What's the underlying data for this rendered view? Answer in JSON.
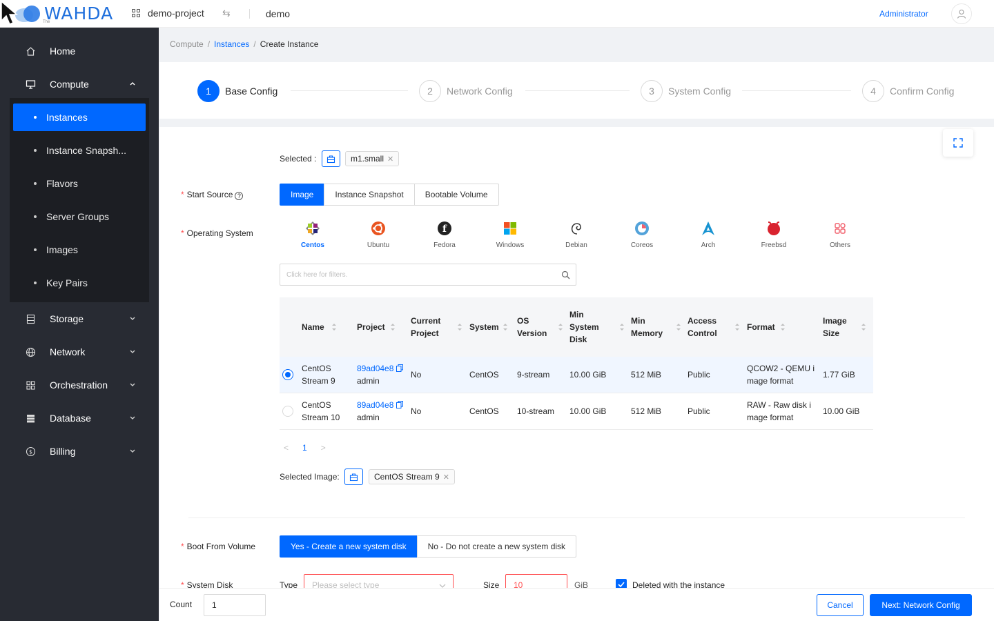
{
  "header": {
    "logo_text": "WAHDA",
    "logo_small": "The",
    "project": "demo-project",
    "domain": "demo",
    "user": "Administrator"
  },
  "sidebar": {
    "items": [
      {
        "label": "Home",
        "icon": "home-icon"
      },
      {
        "label": "Compute",
        "icon": "monitor-icon",
        "expanded": true
      },
      {
        "label": "Storage",
        "icon": "storage-icon"
      },
      {
        "label": "Network",
        "icon": "globe-icon"
      },
      {
        "label": "Orchestration",
        "icon": "grid-icon"
      },
      {
        "label": "Database",
        "icon": "database-icon"
      },
      {
        "label": "Billing",
        "icon": "dollar-icon"
      }
    ],
    "compute_children": [
      "Instances",
      "Instance Snapsh...",
      "Flavors",
      "Server Groups",
      "Images",
      "Key Pairs"
    ],
    "active_child": "Instances"
  },
  "breadcrumb": {
    "items": [
      "Compute",
      "Instances",
      "Create Instance"
    ],
    "sep": "/"
  },
  "steps": [
    {
      "num": "1",
      "title": "Base Config"
    },
    {
      "num": "2",
      "title": "Network Config"
    },
    {
      "num": "3",
      "title": "System Config"
    },
    {
      "num": "4",
      "title": "Confirm Config"
    }
  ],
  "current_step": 1,
  "form": {
    "selected_label": "Selected :",
    "selected_flavor": "m1.small",
    "start_source_label": "Start Source",
    "start_source_options": [
      "Image",
      "Instance Snapshot",
      "Bootable Volume"
    ],
    "start_source_selected": "Image",
    "os_label": "Operating System",
    "os_options": [
      "Centos",
      "Ubuntu",
      "Fedora",
      "Windows",
      "Debian",
      "Coreos",
      "Arch",
      "Freebsd",
      "Others"
    ],
    "os_selected": "Centos",
    "search_placeholder": "Click here for filters.",
    "selected_image_label": "Selected Image:",
    "selected_image": "CentOS Stream 9",
    "boot_label": "Boot From Volume",
    "boot_options": [
      "Yes - Create a new system disk",
      "No - Do not create a new system disk"
    ],
    "boot_selected": "Yes - Create a new system disk",
    "system_disk_label": "System Disk",
    "type_label": "Type",
    "type_placeholder": "Please select type",
    "size_label": "Size",
    "size_value": "10",
    "size_unit": "GiB",
    "delete_with_instance": "Deleted with the instance"
  },
  "table": {
    "columns": [
      "Name",
      "Project",
      "Current Project",
      "System",
      "OS Version",
      "Min System Disk",
      "Min Memory",
      "Access Control",
      "Format",
      "Image Size"
    ],
    "rows": [
      {
        "selected": true,
        "name": "CentOS Stream 9",
        "project_id": "89ad04e8",
        "project_name": "admin",
        "current": "No",
        "system": "CentOS",
        "os_version": "9-stream",
        "min_disk": "10.00 GiB",
        "min_mem": "512 MiB",
        "access": "Public",
        "format": "QCOW2 - QEMU image format",
        "size": "1.77 GiB"
      },
      {
        "selected": false,
        "name": "CentOS Stream 10",
        "project_id": "89ad04e8",
        "project_name": "admin",
        "current": "No",
        "system": "CentOS",
        "os_version": "10-stream",
        "min_disk": "10.00 GiB",
        "min_mem": "512 MiB",
        "access": "Public",
        "format": "RAW - Raw disk image format",
        "size": "10.00 GiB"
      }
    ],
    "page": "1",
    "prev": "<",
    "next": ">"
  },
  "footer": {
    "count_label": "Count",
    "count_value": "1",
    "cancel": "Cancel",
    "next": "Next: Network Config"
  },
  "colors": {
    "accent": "#0068ff",
    "sidebar": "#282b33",
    "error": "#ff4d4f"
  }
}
